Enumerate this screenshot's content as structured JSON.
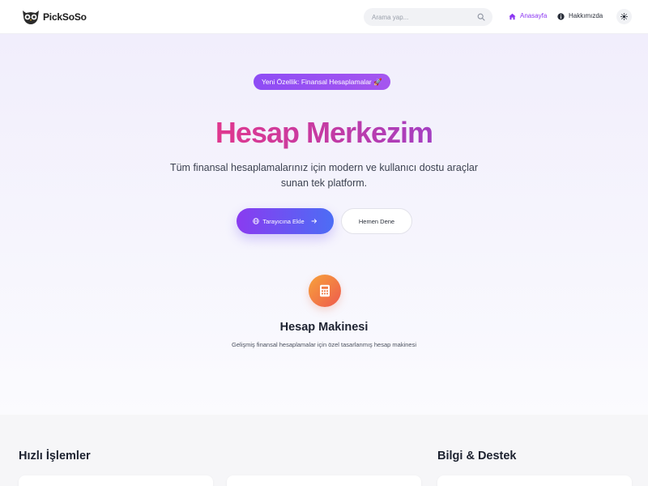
{
  "header": {
    "logo_text": "PickSoSo",
    "search_placeholder": "Arama yap...",
    "nav": {
      "home_label": "Anasayfa",
      "about_label": "Hakkımızda"
    },
    "icons": {
      "logo": "owl-logo-icon",
      "search": "search-icon",
      "home": "home-icon",
      "info": "info-icon",
      "theme": "sun-icon"
    }
  },
  "hero": {
    "badge": "Yeni Özellik: Finansal Hesaplamalar 🚀",
    "title": "Hesap Merkezim",
    "subtitle": "Tüm finansal hesaplamalarınız için modern ve kullanıcı dostu araçlar sunan tek platform.",
    "primary_button": "Tarayıcına Ekle",
    "secondary_button": "Hemen Dene",
    "feature": {
      "icon": "calculator-icon",
      "title": "Hesap Makinesi",
      "description": "Gelişmiş finansal hesaplamalar için özel tasarlanmış hesap makinesi"
    }
  },
  "sections": {
    "quick_actions_title": "Hızlı İşlemler",
    "info_support_title": "Bilgi & Destek"
  },
  "colors": {
    "accent": "#8b36f2",
    "title_gradient_start": "#e0388e",
    "title_gradient_end": "#a43fc2",
    "button_gradient_start": "#8a3bf0",
    "button_gradient_end": "#4c6df5",
    "calc_gradient_start": "#f7a23a",
    "calc_gradient_end": "#ee5a4e"
  }
}
